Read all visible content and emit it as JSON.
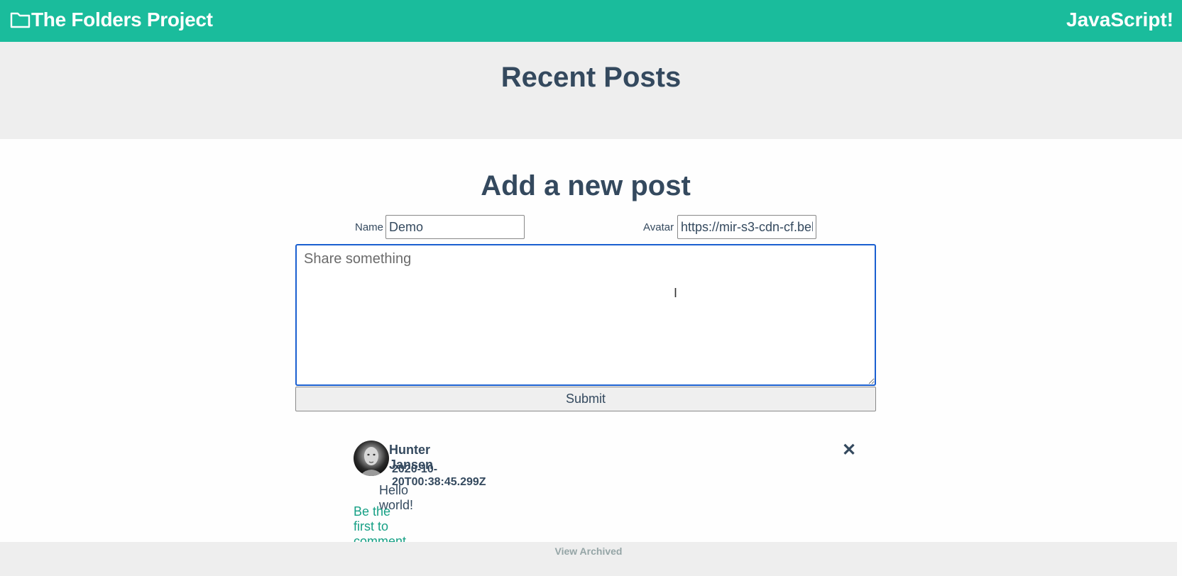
{
  "header": {
    "brand_icon": "folder-icon",
    "brand_title": "The Folders Project",
    "right_link": "JavaScript!"
  },
  "hero": {
    "title": "Recent Posts"
  },
  "form": {
    "title": "Add a new post",
    "name_label": "Name",
    "name_value": "Demo",
    "avatar_label": "Avatar",
    "avatar_value": "https://mir-s3-cdn-cf.bel",
    "body_placeholder": "Share something",
    "submit_label": "Submit"
  },
  "posts": [
    {
      "author": "Hunter Jansen",
      "timestamp": "2020-10-20T00:38:45.299Z",
      "body": "Hello world!",
      "comment_link": "Be the first to comment",
      "delete_icon": "close-icon"
    }
  ],
  "footer": {
    "link": "View Archived"
  },
  "colors": {
    "accent": "#1abc9c",
    "text": "#34495e",
    "link": "#16a085",
    "muted": "#95a5a6",
    "panel": "#eeeeee",
    "focus": "#1a5fd0"
  }
}
